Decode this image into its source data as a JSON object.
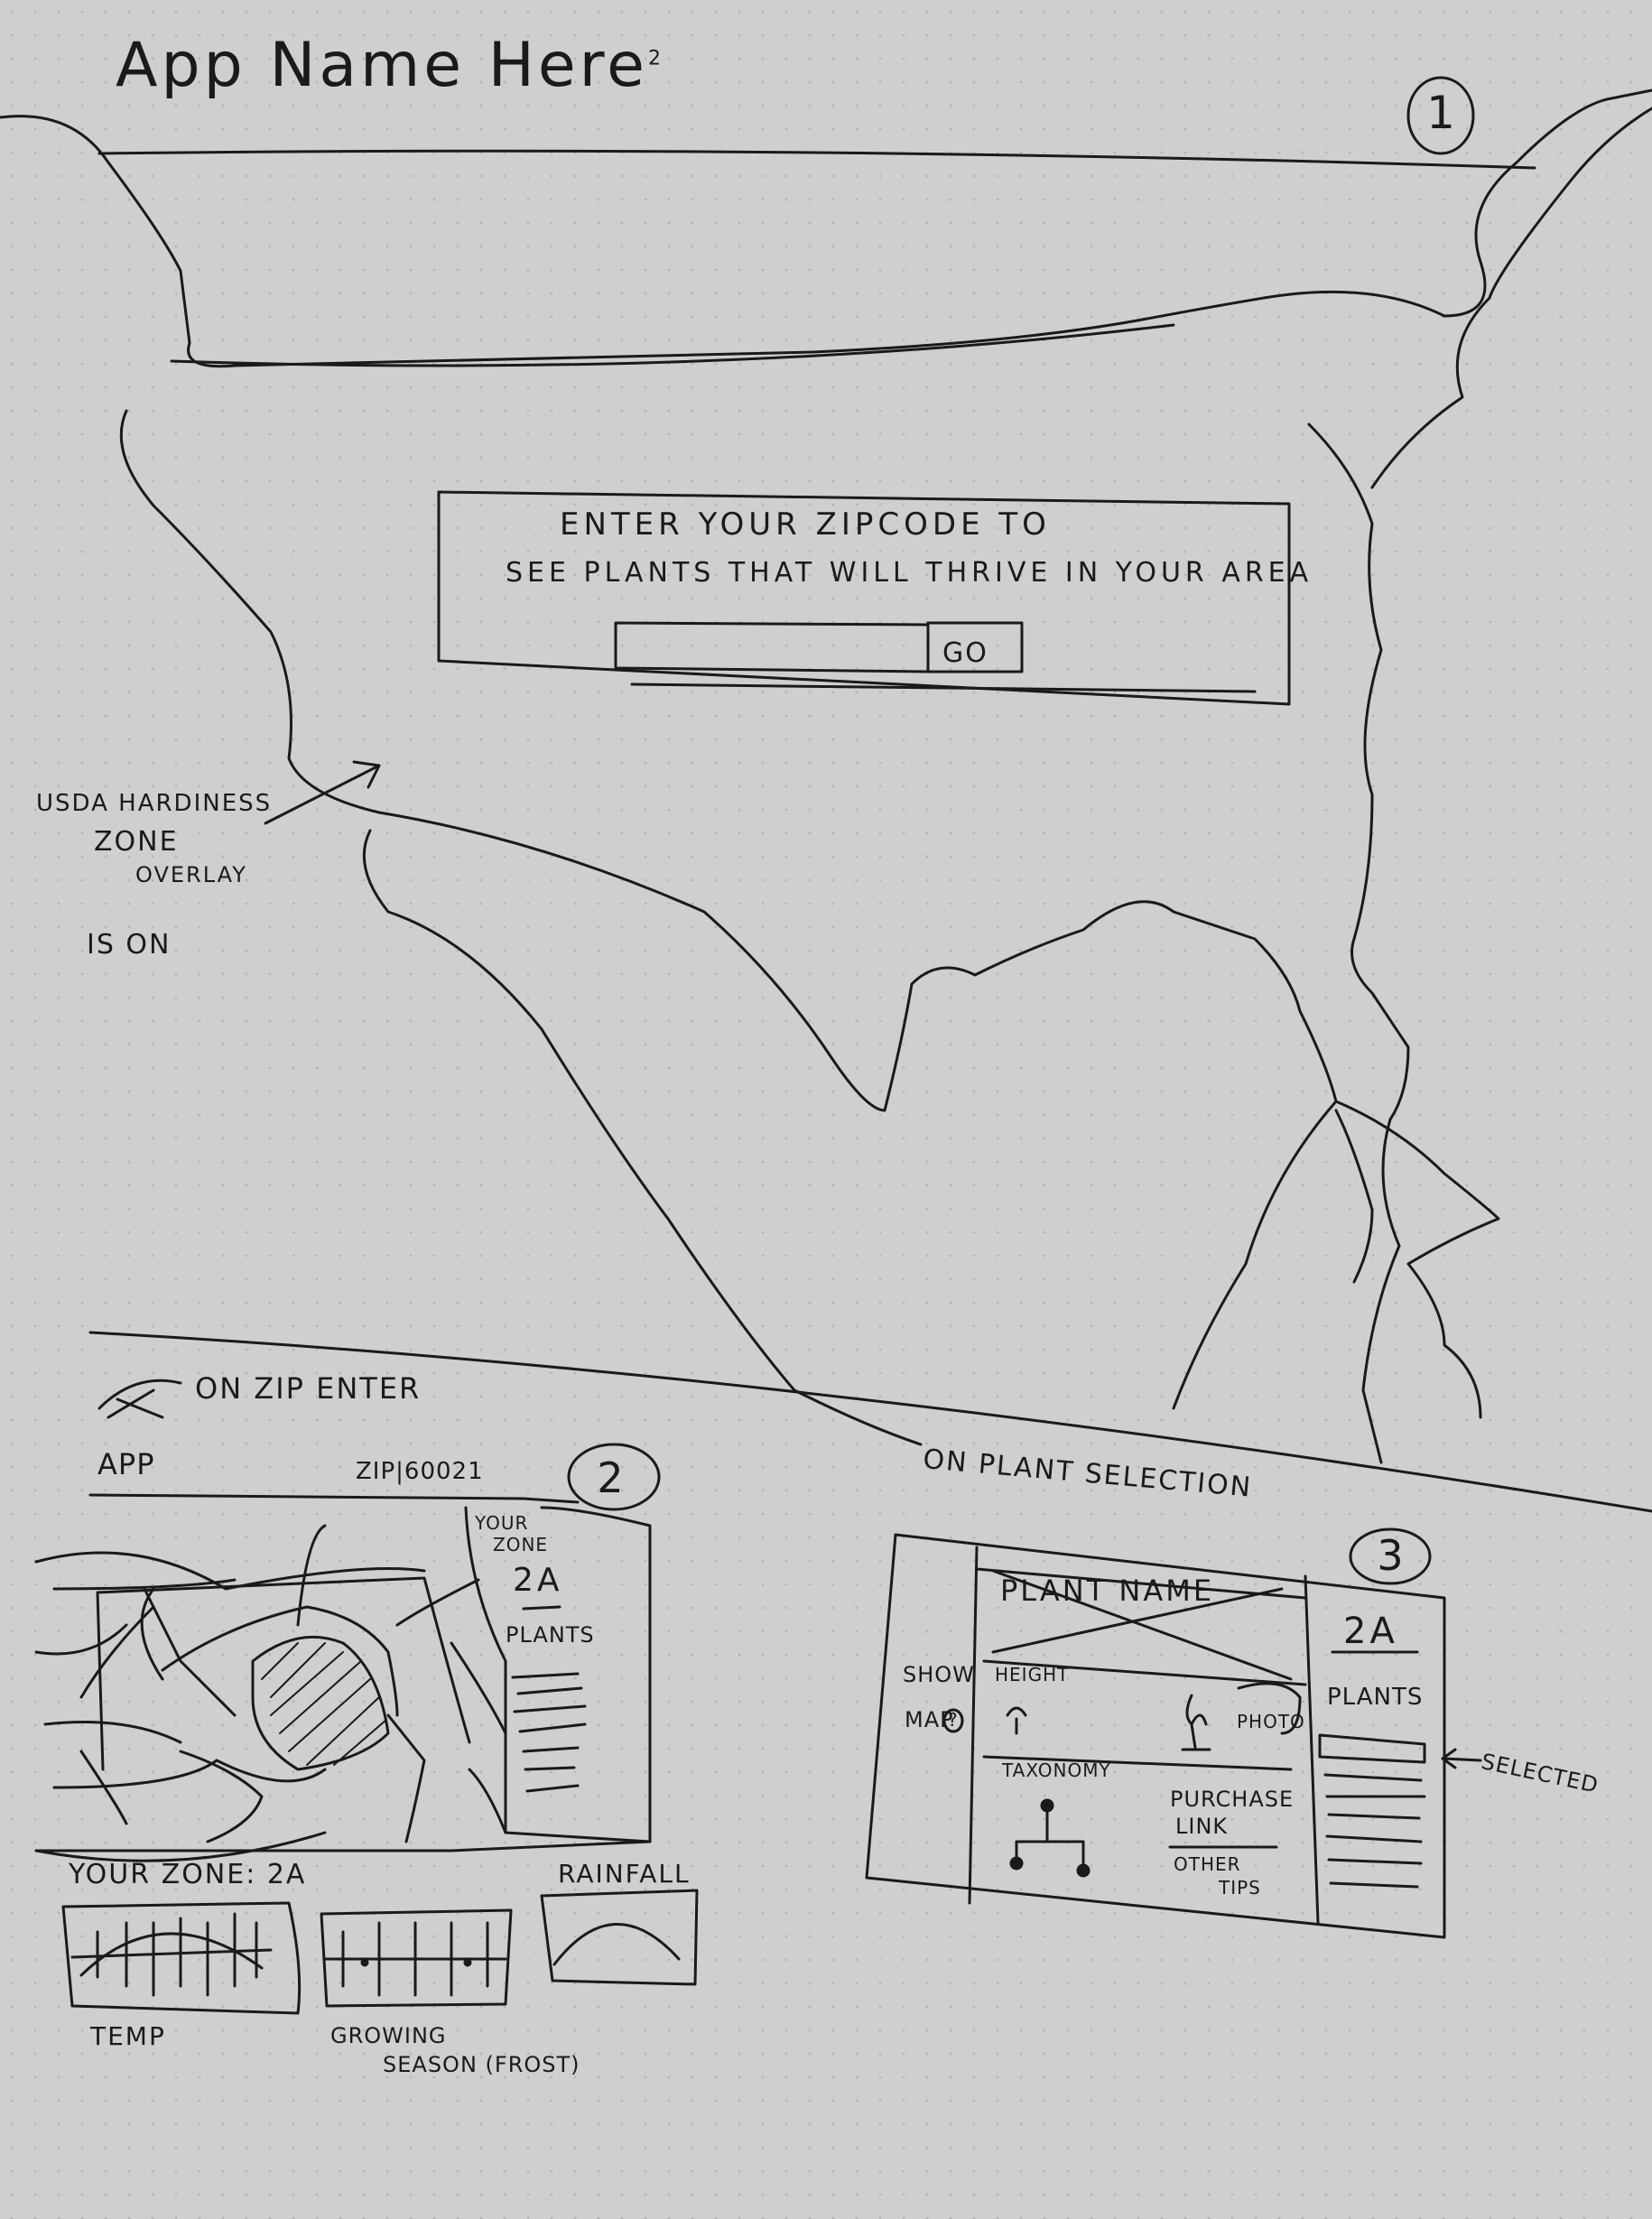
{
  "screen1": {
    "number": "1",
    "app_title": "App Name Here",
    "title_superscript": "2",
    "prompt_line1": "ENTER YOUR ZIPCODE TO",
    "prompt_line2": "SEE PLANTS THAT WILL THRIVE IN YOUR AREA",
    "zip_input_value": "",
    "go_label": "GO",
    "annotation": [
      "USDA HARDINESS",
      "ZONE",
      "OVERLAY",
      "IS ON"
    ]
  },
  "flow_labels": {
    "on_zip_enter": "ON ZIP ENTER",
    "on_plant_selection": "ON PLANT SELECTION"
  },
  "screen2": {
    "number": "2",
    "app_label": "APP",
    "zip_value": "ZIP|60021",
    "sidebar_zone_label": [
      "YOUR",
      "ZONE"
    ],
    "sidebar_zone_value": "2A",
    "sidebar_plants_label": "PLANTS",
    "your_zone_text": "YOUR ZONE: 2A",
    "chart_labels": {
      "temp": "TEMP",
      "growing_season": [
        "GROWING",
        "SEASON (FROST)"
      ],
      "rainfall": "RAINFALL"
    }
  },
  "screen3": {
    "number": "3",
    "plant_name": "PLANT NAME",
    "show_map": [
      "SHOW",
      "MAP"
    ],
    "show_map_icon": "?",
    "height_label": "HEIGHT",
    "photo_label": "PHOTO",
    "taxonomy_label": "TAXONOMY",
    "purchase_link": [
      "PURCHASE",
      "LINK"
    ],
    "other_tips": [
      "OTHER",
      "TIPS"
    ],
    "zone_value": "2A",
    "plants_label": "PLANTS",
    "selected_label": "SELECTED"
  },
  "colors": {
    "paper": "#cfcfcf",
    "ink": "#1a1a1a"
  }
}
